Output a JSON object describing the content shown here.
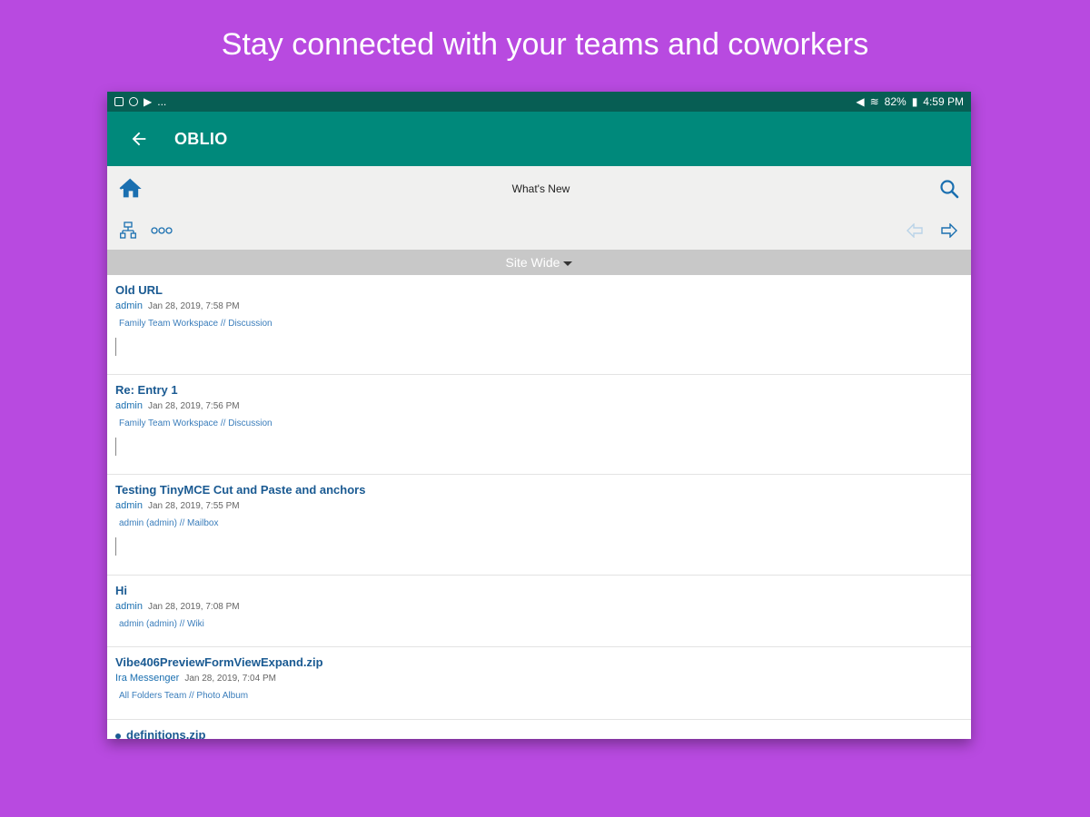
{
  "headline": "Stay connected with your teams and coworkers",
  "status_bar": {
    "left_dots": "...",
    "battery": "82%",
    "time": "4:59 PM"
  },
  "app_bar": {
    "title": "OBLIO"
  },
  "toolbar": {
    "title": "What's New"
  },
  "filter": {
    "label": "Site Wide"
  },
  "items": [
    {
      "title": "Old URL",
      "author": "admin",
      "date": "Jan 28, 2019, 7:58 PM",
      "path": "Family Team Workspace // Discussion"
    },
    {
      "title": "Re: Entry 1",
      "author": "admin",
      "date": "Jan 28, 2019, 7:56 PM",
      "path": "Family Team Workspace // Discussion"
    },
    {
      "title": "Testing TinyMCE Cut and Paste and anchors",
      "author": "admin",
      "date": "Jan 28, 2019, 7:55 PM",
      "path": "admin (admin) // Mailbox"
    },
    {
      "title": "Hi",
      "author": "admin",
      "date": "Jan 28, 2019, 7:08 PM",
      "path": "admin (admin) // Wiki"
    },
    {
      "title": "Vibe406PreviewFormViewExpand.zip",
      "author": "Ira Messenger",
      "date": "Jan 28, 2019, 7:04 PM",
      "path": "All Folders Team // Photo Album"
    },
    {
      "title": "definitions.zip"
    }
  ],
  "colors": {
    "background": "#b84ae0",
    "status_bar": "#075e54",
    "app_bar": "#00897b",
    "link": "#1a5a92"
  }
}
